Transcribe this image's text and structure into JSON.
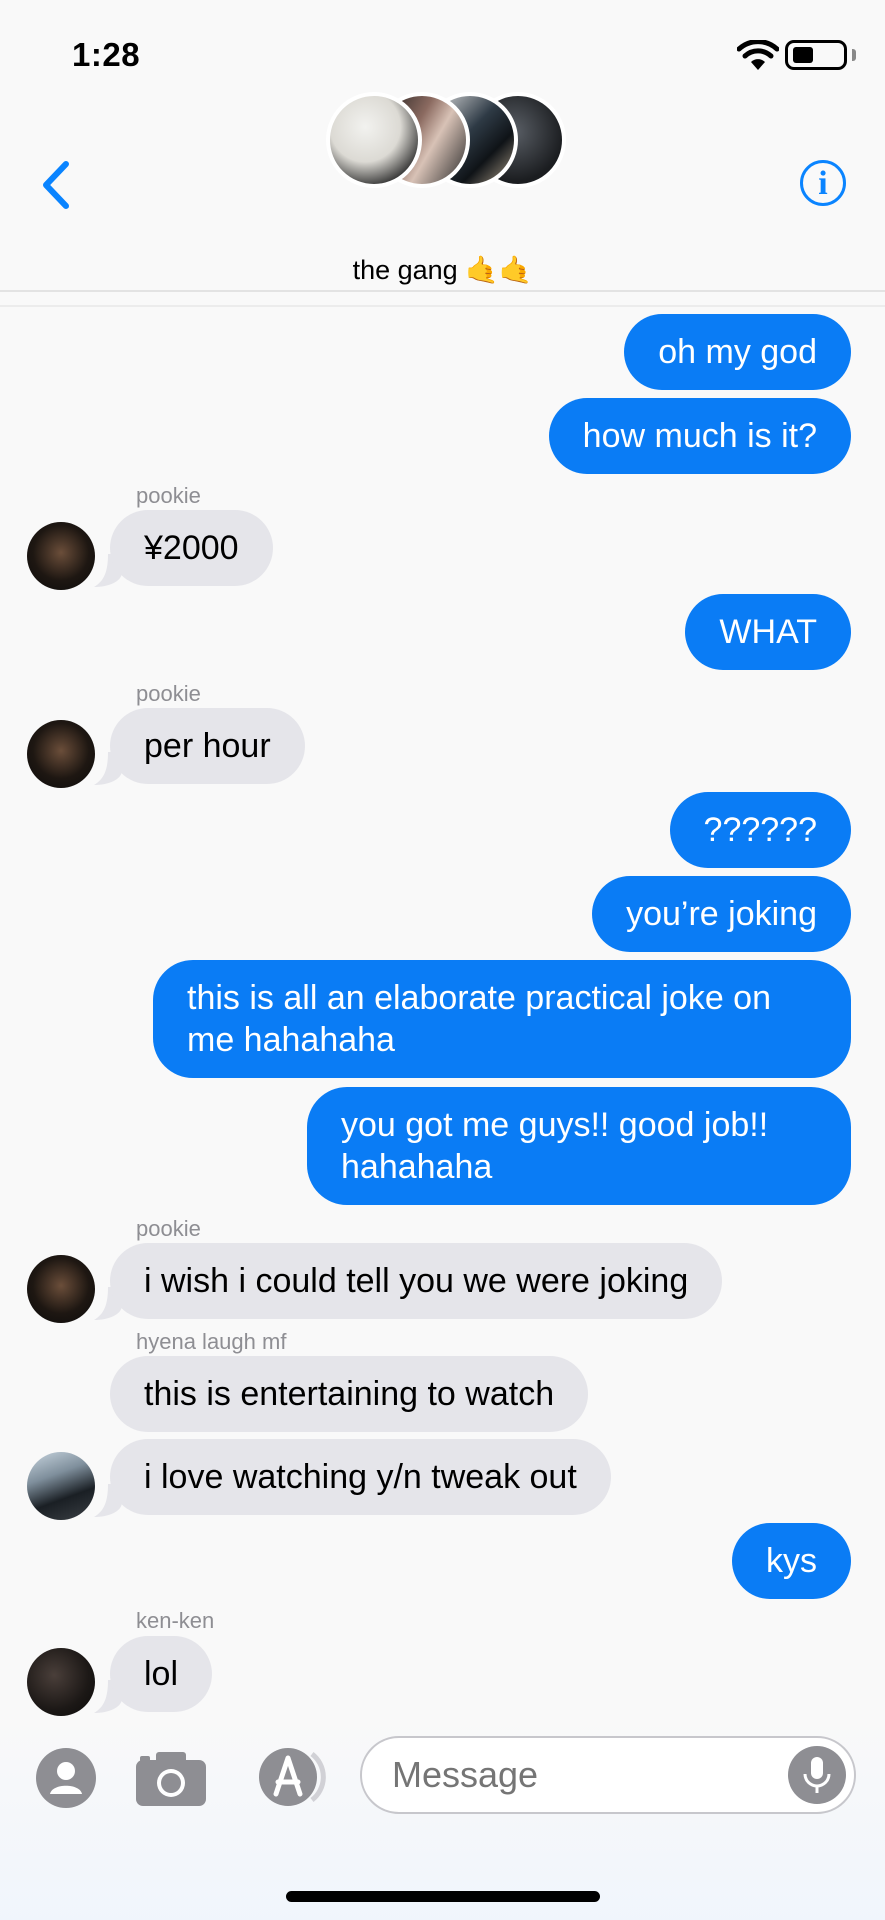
{
  "status_bar": {
    "time": "1:28"
  },
  "header": {
    "group_name": "the gang 🤙🤙",
    "back_icon": "chevron-left-icon",
    "info_icon": "info-icon",
    "info_glyph": "i"
  },
  "messages": {
    "m1": {
      "text": "oh my god"
    },
    "m2": {
      "text": "how much is it?"
    },
    "s1": {
      "sender": "pookie"
    },
    "m3": {
      "text": "¥2000"
    },
    "m4": {
      "text": "WHAT"
    },
    "s2": {
      "sender": "pookie"
    },
    "m5": {
      "text": "per hour"
    },
    "m6": {
      "text": "??????"
    },
    "m7": {
      "text": "you’re joking"
    },
    "m8": {
      "text": "this is all an elaborate practical joke on me hahahaha"
    },
    "m9": {
      "text": "you got me guys!! good job!! hahahaha"
    },
    "s3": {
      "sender": "pookie"
    },
    "m10": {
      "text": "i wish i could tell you we were joking"
    },
    "s4": {
      "sender": "hyena laugh mf"
    },
    "m11": {
      "text": "this is entertaining to watch"
    },
    "m12": {
      "text": "i love watching y/n tweak out"
    },
    "m13": {
      "text": "kys"
    },
    "s5": {
      "sender": "ken-ken"
    },
    "m14": {
      "text": "lol"
    }
  },
  "composer": {
    "placeholder": "Message"
  },
  "colors": {
    "outgoing": "#0a7cf5",
    "incoming": "#e5e5ea",
    "accent": "#0a84ff"
  }
}
